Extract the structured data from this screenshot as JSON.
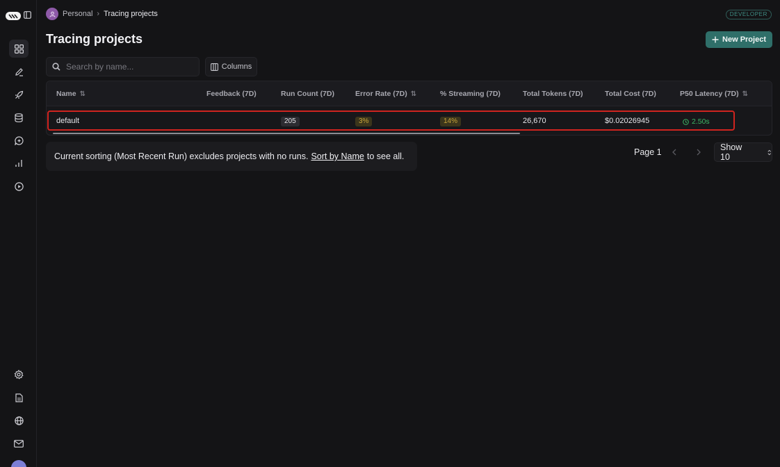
{
  "breadcrumb": {
    "workspace": "Personal",
    "separator": "›",
    "current": "Tracing projects"
  },
  "env_badge": "DEVELOPER",
  "page_title": "Tracing projects",
  "new_project_label": "New Project",
  "search": {
    "placeholder": "Search by name..."
  },
  "columns_label": "Columns",
  "table": {
    "headers": {
      "name": "Name",
      "feedback": "Feedback (7D)",
      "run_count": "Run Count (7D)",
      "error_rate": "Error Rate (7D)",
      "streaming": "% Streaming (7D)",
      "tokens": "Total Tokens (7D)",
      "cost": "Total Cost (7D)",
      "latency": "P50 Latency (7D)"
    },
    "rows": [
      {
        "name": "default",
        "run_count": "205",
        "error_rate": "3%",
        "streaming": "14%",
        "tokens": "26,670",
        "cost": "$0.02026945",
        "latency": "2.50s"
      }
    ]
  },
  "notice": {
    "before": "Current sorting (Most Recent Run) excludes projects with no runs.",
    "link": "Sort by Name",
    "after": "to see all."
  },
  "pagination": {
    "page_label": "Page 1",
    "show_label": "Show 10"
  },
  "colors": {
    "accent": "#2f6f69",
    "highlight": "#d0241f",
    "latency_ok": "#3cb866",
    "warning": "#c8a63a"
  }
}
